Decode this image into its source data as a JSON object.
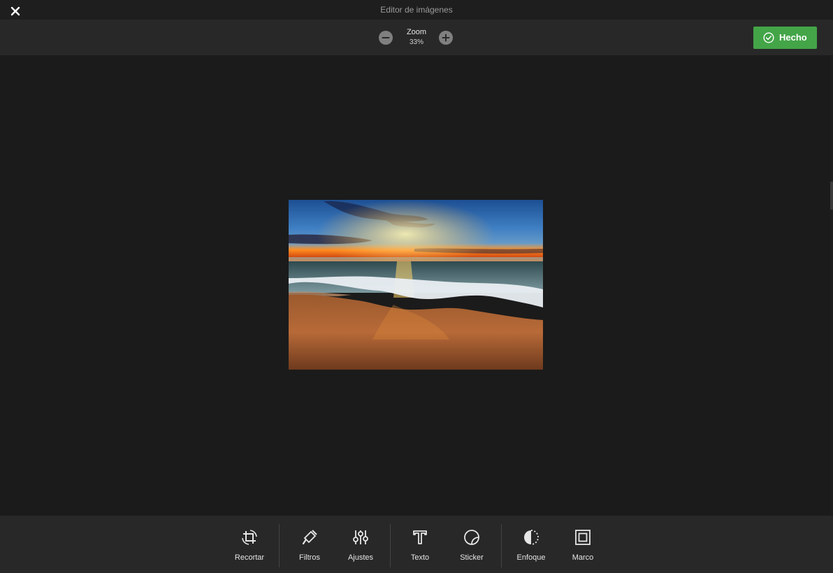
{
  "window": {
    "title": "Editor de imágenes"
  },
  "zoom": {
    "label": "Zoom",
    "value": "33%"
  },
  "done": {
    "label": "Hecho"
  },
  "colors": {
    "accent": "#43a548",
    "background": "#1b1b1b",
    "toolbar": "#282828"
  },
  "tools": [
    {
      "label": "Recortar",
      "icon": "crop-icon"
    },
    {
      "label": "Filtros",
      "icon": "brush-icon"
    },
    {
      "label": "Ajustes",
      "icon": "sliders-icon"
    },
    {
      "label": "Texto",
      "icon": "text-icon"
    },
    {
      "label": "Sticker",
      "icon": "sticker-icon"
    },
    {
      "label": "Enfoque",
      "icon": "focus-icon"
    },
    {
      "label": "Marco",
      "icon": "frame-icon"
    }
  ]
}
